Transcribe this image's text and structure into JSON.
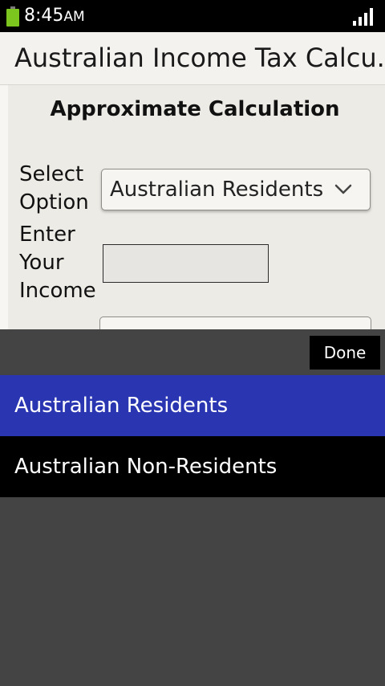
{
  "status_bar": {
    "time": "8:45",
    "ampm": "AM",
    "battery_color": "#7cc51f"
  },
  "app": {
    "title": "Australian Income Tax Calcu...",
    "subtitle": "Approximate Calculation",
    "select_label_line1": "Select",
    "select_label_line2": "Option",
    "select_value": "Australian Residents",
    "income_label_line1": "Enter",
    "income_label_line2": "Your",
    "income_label_line3": "Income",
    "income_value": ""
  },
  "picker": {
    "done_label": "Done",
    "options": [
      {
        "label": "Australian Residents",
        "selected": true
      },
      {
        "label": "Australian Non-Residents",
        "selected": false
      }
    ],
    "selected_color": "#2a36b1"
  }
}
